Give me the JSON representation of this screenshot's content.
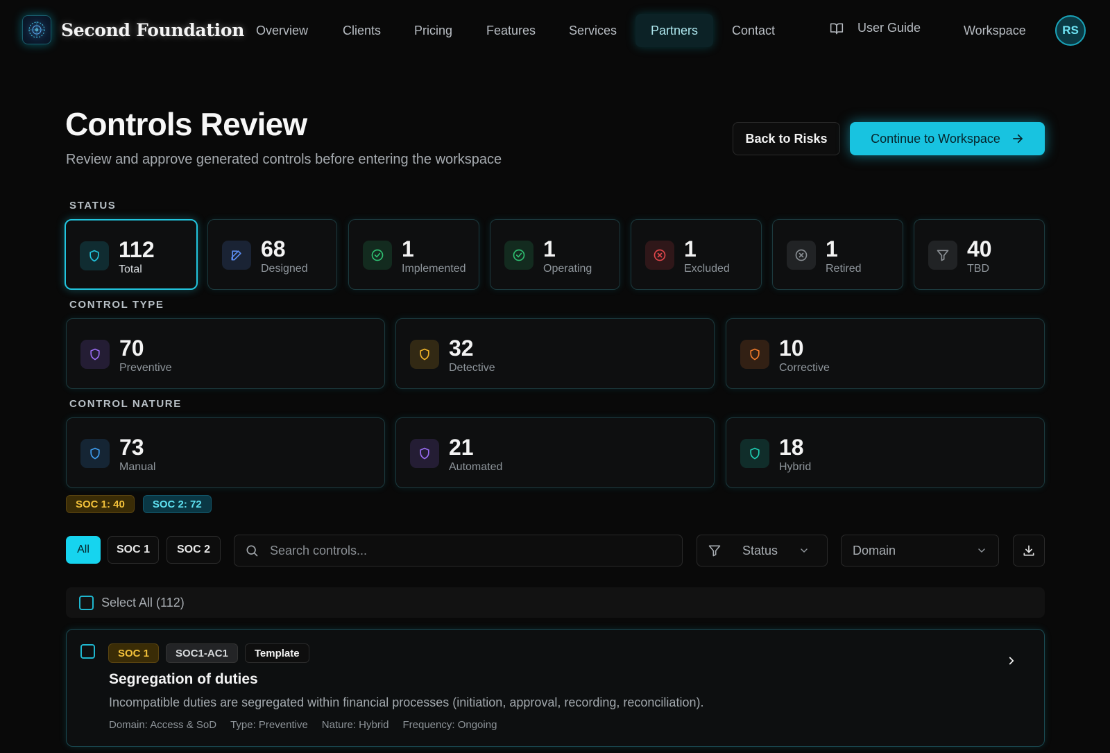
{
  "brand": {
    "name": "Second Foundation"
  },
  "nav": {
    "items": [
      {
        "label": "Overview"
      },
      {
        "label": "Clients"
      },
      {
        "label": "Pricing"
      },
      {
        "label": "Features"
      },
      {
        "label": "Services"
      },
      {
        "label": "Partners",
        "active": true
      },
      {
        "label": "Contact"
      }
    ],
    "guide_label": "User Guide",
    "workspace_label": "Workspace",
    "avatar_initials": "RS"
  },
  "header": {
    "title": "Controls Review",
    "subtitle": "Review and approve generated controls before entering the workspace",
    "back_label": "Back to Risks",
    "continue_label": "Continue to Workspace"
  },
  "status": {
    "section_label": "STATUS",
    "cards": [
      {
        "value": "112",
        "label": "Total",
        "icon": "shield-icon",
        "color": "#22c5de",
        "selected": true
      },
      {
        "value": "68",
        "label": "Designed",
        "icon": "edit-icon",
        "color": "#5b8cf0"
      },
      {
        "value": "1",
        "label": "Implemented",
        "icon": "check-circle-icon",
        "color": "#2fbf71"
      },
      {
        "value": "1",
        "label": "Operating",
        "icon": "check-circle-icon",
        "color": "#2fbf71"
      },
      {
        "value": "1",
        "label": "Excluded",
        "icon": "x-circle-icon",
        "color": "#e0464a"
      },
      {
        "value": "1",
        "label": "Retired",
        "icon": "x-circle-icon",
        "color": "#8a8f94"
      },
      {
        "value": "40",
        "label": "TBD",
        "icon": "filter-icon",
        "color": "#8a8f94"
      }
    ]
  },
  "control_type": {
    "section_label": "CONTROL TYPE",
    "cards": [
      {
        "value": "70",
        "label": "Preventive",
        "icon": "shield-icon",
        "color": "#9a6cf2"
      },
      {
        "value": "32",
        "label": "Detective",
        "icon": "shield-icon",
        "color": "#f0b429"
      },
      {
        "value": "10",
        "label": "Corrective",
        "icon": "shield-icon",
        "color": "#f07a2a"
      }
    ]
  },
  "control_nature": {
    "section_label": "CONTROL NATURE",
    "cards": [
      {
        "value": "73",
        "label": "Manual",
        "icon": "shield-icon",
        "color": "#3f9ef0"
      },
      {
        "value": "21",
        "label": "Automated",
        "icon": "shield-icon",
        "color": "#9a6cf2"
      },
      {
        "value": "18",
        "label": "Hybrid",
        "icon": "shield-icon",
        "color": "#1fcfb4"
      }
    ]
  },
  "framework_counts": [
    "SOC 1: 40",
    "SOC 2: 72"
  ],
  "filters": {
    "tabs": [
      "All",
      "SOC 1",
      "SOC 2"
    ],
    "search_placeholder": "Search controls...",
    "status_label": "Status",
    "domain_label": "Domain"
  },
  "list": {
    "select_all_label": "Select All (112)",
    "items": [
      {
        "framework": "SOC 1",
        "code": "SOC1-AC1",
        "source": "Template",
        "title": "Segregation of duties",
        "description": "Incompatible duties are segregated within financial processes (initiation, approval, recording, reconciliation).",
        "meta": [
          "Domain: Access & SoD",
          "Type: Preventive",
          "Nature: Hybrid",
          "Frequency: Ongoing"
        ]
      }
    ]
  },
  "colors": {
    "accent": "#18c3e0",
    "background": "#090909",
    "soc1": "#f3c13a",
    "soc2": "#5fe0f0"
  }
}
